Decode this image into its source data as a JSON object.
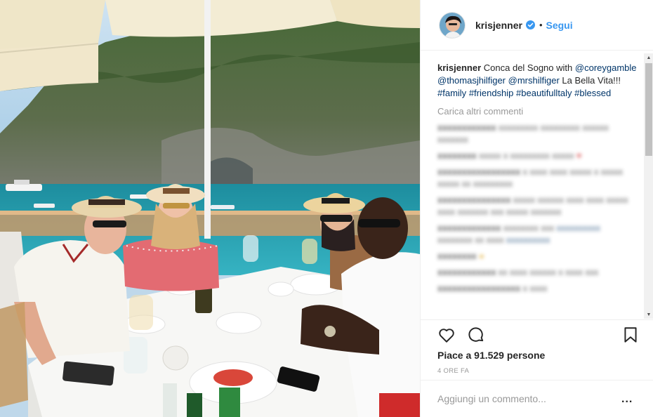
{
  "post": {
    "username": "krisjenner",
    "follow_label": "Segui",
    "separator": "•",
    "caption": {
      "username": "krisjenner",
      "text": "Conca del Sogno with",
      "mentions": [
        "@coreygamble",
        "@thomasjhilfiger",
        "@mrshilfiger"
      ],
      "middle_text": "La Bella Vita!!!",
      "hashtags": [
        "#family",
        "#friendship",
        "#beautifulltaly",
        "#blessed"
      ]
    },
    "load_more_label": "Carica altri commenti",
    "likes_label": "Piace a 91.529 persone",
    "time_label": "4 ORE FA",
    "comment_placeholder": "Aggiungi un commento...",
    "more_options_label": "..."
  },
  "icons": {
    "verified": "verified-badge-icon",
    "like": "heart-icon",
    "comment": "comment-icon",
    "save": "bookmark-icon",
    "scroll_up": "scroll-up-icon",
    "scroll_down": "scroll-down-icon"
  },
  "colors": {
    "link_blue": "#3897f0",
    "hashtag_blue": "#003569",
    "muted_gray": "#999999",
    "border": "#efefef"
  }
}
